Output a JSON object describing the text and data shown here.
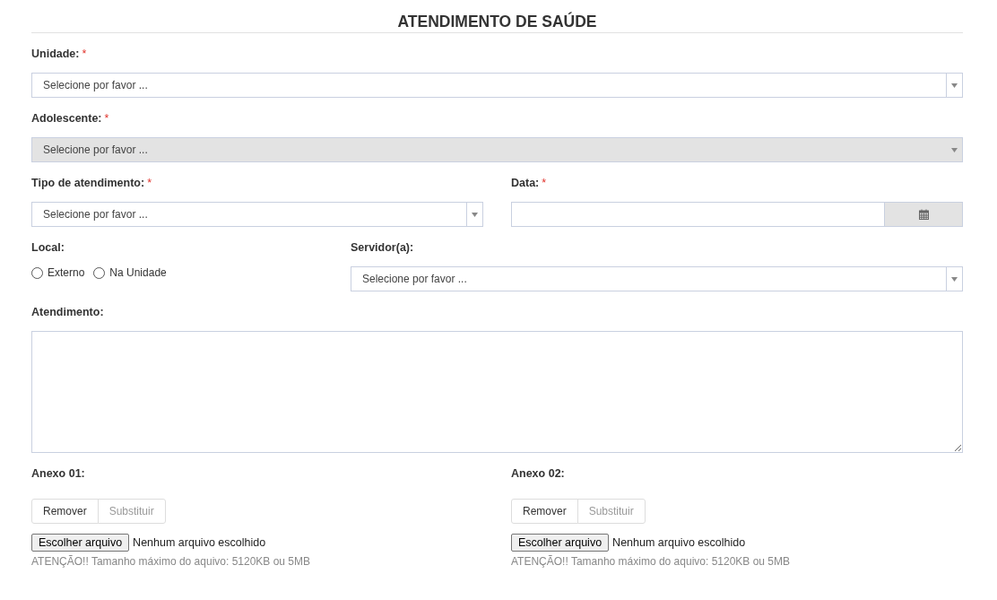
{
  "title": "ATENDIMENTO DE SAÚDE",
  "rows": [
    [
      {
        "kind": "select",
        "label": "Unidade:",
        "required_mark": "*",
        "placeholder": "Selecione por favor ...",
        "disabled": false
      }
    ],
    [
      {
        "kind": "select",
        "label": "Adolescente:",
        "required_mark": "*",
        "placeholder": "Selecione por favor ...",
        "disabled": true
      }
    ],
    [
      {
        "kind": "select",
        "label": "Tipo de atendimento:",
        "required_mark": "*",
        "placeholder": "Selecione por favor ...",
        "disabled": false
      },
      {
        "kind": "date",
        "label": "Data:",
        "required_mark": "*"
      }
    ],
    [
      {
        "kind": "radio",
        "label": "Local:",
        "options": [
          {
            "label": "Externo",
            "selected": false
          },
          {
            "label": "Na Unidade",
            "selected": false
          }
        ]
      },
      {
        "kind": "select",
        "label": "Servidor(a):",
        "placeholder": "Selecione por favor ...",
        "disabled": false
      }
    ],
    [
      {
        "kind": "textarea",
        "label": "Atendimento:"
      }
    ],
    [
      {
        "kind": "attachment",
        "label": "Anexo 01:",
        "buttons": [
          {
            "label": "Remover",
            "disabled": false
          },
          {
            "label": "Substituir",
            "disabled": true
          }
        ],
        "file_button": "Escolher arquivo",
        "file_status": "Nenhum arquivo escolhido",
        "note": "ATENÇÃO!! Tamanho máximo do aquivo: 5120KB ou 5MB"
      },
      {
        "kind": "attachment",
        "label": "Anexo 02:",
        "buttons": [
          {
            "label": "Remover",
            "disabled": false
          },
          {
            "label": "Substituir",
            "disabled": true
          }
        ],
        "file_button": "Escolher arquivo",
        "file_status": "Nenhum arquivo escolhido",
        "note": "ATENÇÃO!! Tamanho máximo do aquivo: 5120KB ou 5MB"
      }
    ]
  ]
}
